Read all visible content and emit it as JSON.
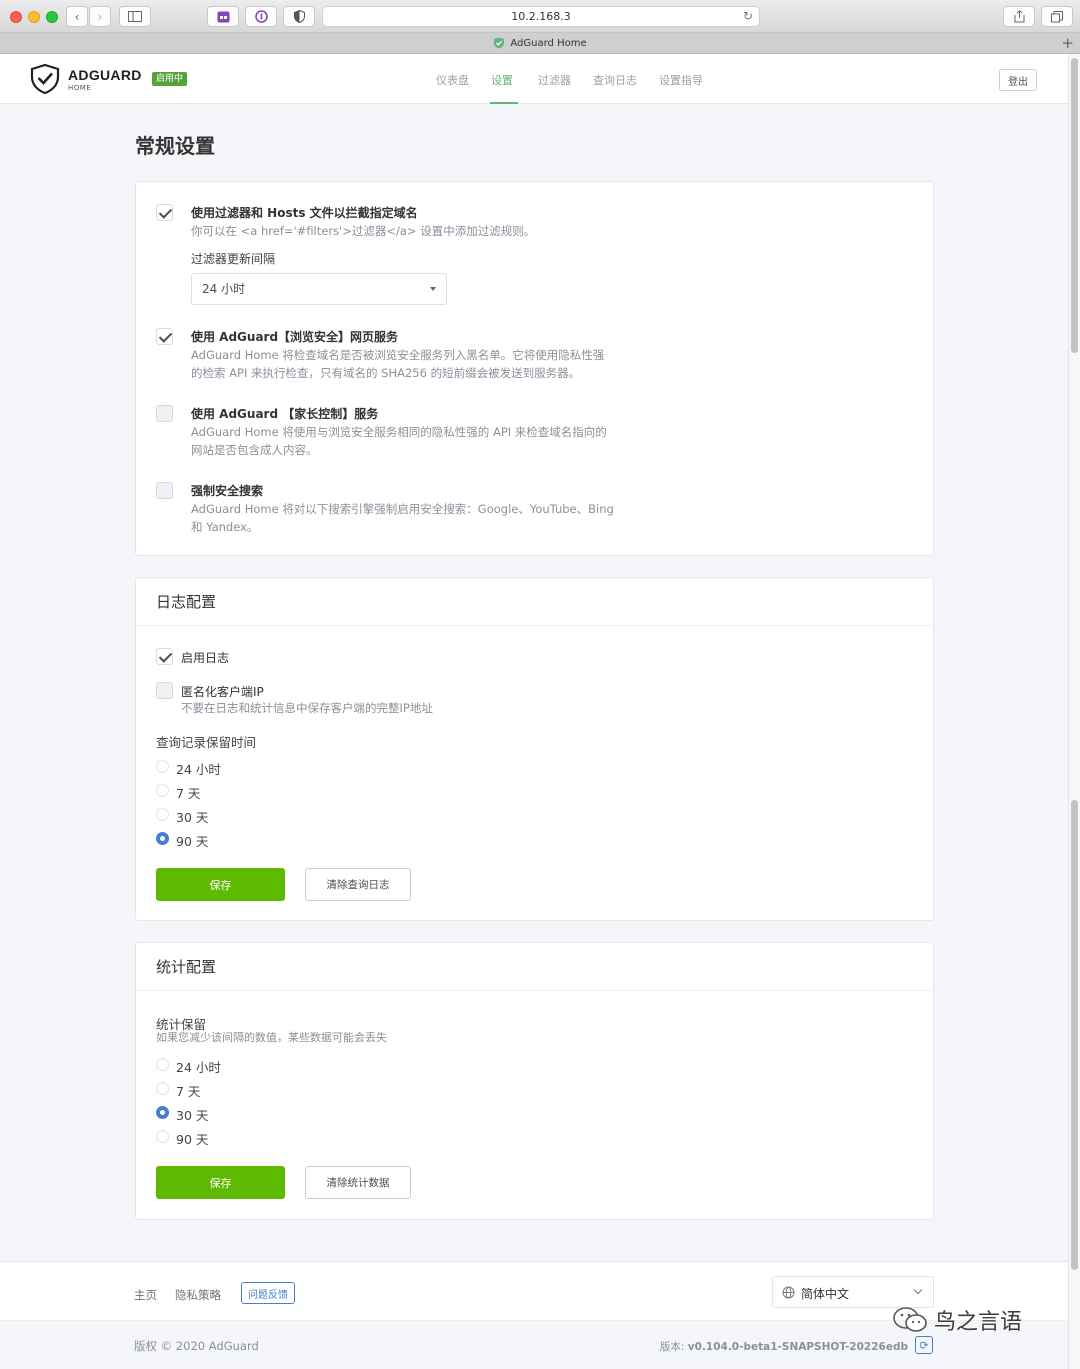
{
  "browser": {
    "url": "10.2.168.3",
    "tab_title": "AdGuard Home"
  },
  "header": {
    "brand": "ADGUARD",
    "brand_sub": "HOME",
    "status_badge": "启用中",
    "nav": [
      "仪表盘",
      "设置",
      "过滤器",
      "查询日志",
      "设置指导"
    ],
    "active_nav": "设置",
    "logout": "登出"
  },
  "page_title": "常规设置",
  "general": {
    "filter": {
      "title": "使用过滤器和 Hosts 文件以拦截指定域名",
      "desc": "你可以在 <a href='#filters'>过滤器</a> 设置中添加过滤规则。",
      "checked": true
    },
    "interval_label": "过滤器更新间隔",
    "interval_value": "24 小时",
    "safebrowsing": {
      "title": "使用 AdGuard【浏览安全】网页服务",
      "desc1": "AdGuard Home 将检查域名是否被浏览安全服务列入黑名单。它将使用隐私性强",
      "desc2": "的检索 API 来执行检查，只有域名的 SHA256 的短前缀会被发送到服务器。",
      "checked": true
    },
    "parental": {
      "title": "使用 AdGuard 【家长控制】服务",
      "desc1": "AdGuard Home 将使用与浏览安全服务相同的隐私性强的 API 来检查域名指向的",
      "desc2": "网站是否包含成人内容。",
      "checked": false
    },
    "safesearch": {
      "title": "强制安全搜索",
      "desc1": "AdGuard Home 将对以下搜索引擎强制启用安全搜索：Google、YouTube、Bing",
      "desc2": "和 Yandex。",
      "checked": false
    }
  },
  "log": {
    "title": "日志配置",
    "enable_label": "启用日志",
    "enable_checked": true,
    "anon_label": "匿名化客户端IP",
    "anon_desc": "不要在日志和统计信息中保存客户端的完整IP地址",
    "anon_checked": false,
    "retention_label": "查询记录保留时间",
    "options": [
      "24 小时",
      "7 天",
      "30 天",
      "90 天"
    ],
    "selected": "90 天",
    "save": "保存",
    "clear": "清除查询日志"
  },
  "stats": {
    "title": "统计配置",
    "retention_label": "统计保留",
    "retention_desc": "如果您减少该间隔的数值，某些数据可能会丢失",
    "options": [
      "24 小时",
      "7 天",
      "30 天",
      "90 天"
    ],
    "selected": "30 天",
    "save": "保存",
    "clear": "清除统计数据"
  },
  "footer": {
    "home": "主页",
    "privacy": "隐私策略",
    "report": "问题反馈",
    "language": "简体中文",
    "copyright": "版权 © 2020 AdGuard",
    "version_label": "版本: ",
    "version_value": "v0.104.0-beta1-SNAPSHOT-20226edb"
  },
  "watermark": "鸟之言语",
  "colors": {
    "accent_green": "#5eba00",
    "nav_active": "#67b279",
    "radio_blue": "#467fcf",
    "badge_green": "#56a33b"
  }
}
